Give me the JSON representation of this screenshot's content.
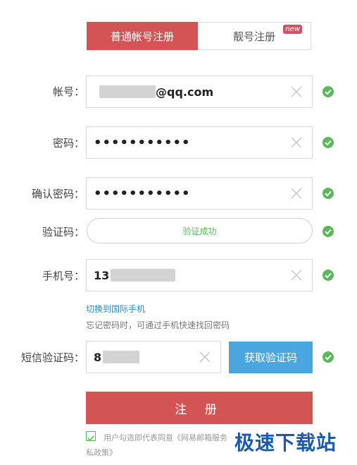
{
  "tabs": {
    "normal_account": "普通帐号注册",
    "vip_account": "靓号注册",
    "new_badge": "new"
  },
  "account": {
    "label": "帐号：",
    "value_suffix": "@qq.com"
  },
  "password": {
    "label": "密码：",
    "value": "•••••••••••"
  },
  "confirm_password": {
    "label": "确认密码：",
    "value": "•••••••••••"
  },
  "captcha": {
    "label": "验证码：",
    "status": "验证成功"
  },
  "phone": {
    "label": "手机号：",
    "value_prefix": "13",
    "switch_link": "切换到国际手机",
    "hint": "忘记密码时，可通过手机快速找回密码"
  },
  "sms_code": {
    "label": "短信验证码：",
    "value_prefix": "8",
    "button": "获取验证码"
  },
  "submit": {
    "label": "注 册"
  },
  "agreement": {
    "text_line1": "用户勾选即代表同意《网易邮箱服务",
    "text_line2": "私政策》",
    "checked": true
  },
  "watermark": {
    "text": "极速下载站"
  },
  "colors": {
    "primary_red": "#d25454",
    "button_blue": "#4aa6df",
    "success_green": "#5cb85c",
    "link_blue": "#2a8ad4"
  }
}
